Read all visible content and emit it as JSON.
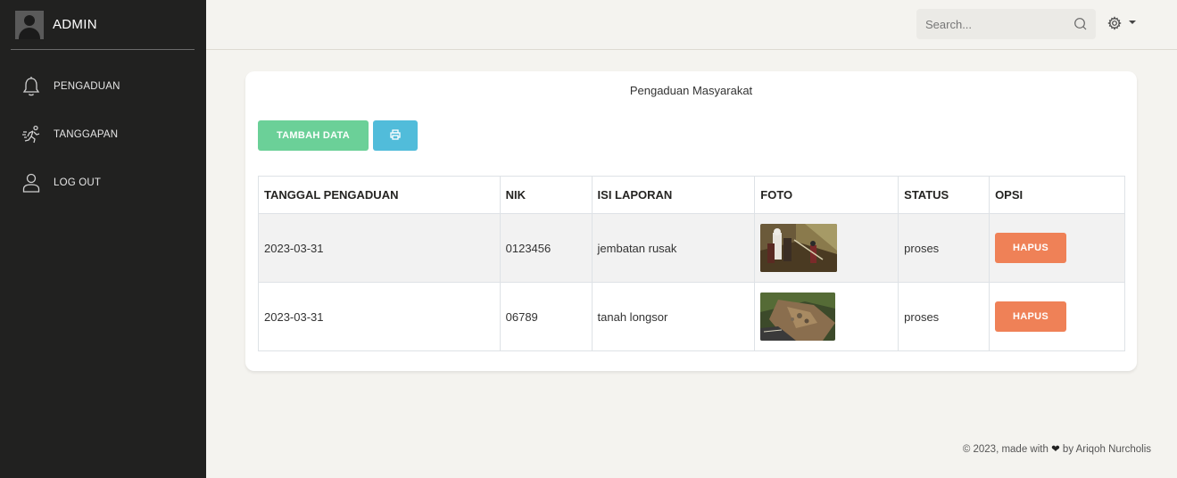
{
  "sidebar": {
    "brand": "ADMIN",
    "items": [
      {
        "label": "PENGADUAN",
        "icon": "bell-icon"
      },
      {
        "label": "TANGGAPAN",
        "icon": "runner-icon"
      },
      {
        "label": "LOG OUT",
        "icon": "user-icon"
      }
    ]
  },
  "topbar": {
    "search_placeholder": "Search..."
  },
  "card": {
    "title": "Pengaduan Masyarakat",
    "add_button": "TAMBAH DATA"
  },
  "table": {
    "headers": [
      "TANGGAL PENGADUAN",
      "NIK",
      "ISI LAPORAN",
      "FOTO",
      "STATUS",
      "OPSI"
    ],
    "rows": [
      {
        "date": "2023-03-31",
        "nik": "0123456",
        "report": "jembatan rusak",
        "status": "proses",
        "action": "HAPUS"
      },
      {
        "date": "2023-03-31",
        "nik": "06789",
        "report": "tanah longsor",
        "status": "proses",
        "action": "HAPUS"
      }
    ]
  },
  "footer": {
    "prefix": "© 2023, made with",
    "heart": "❤",
    "suffix": "by Ariqoh Nurcholis"
  },
  "colors": {
    "sidebar_bg": "#212120",
    "page_bg": "#f4f3ef",
    "success": "#6bd098",
    "info": "#51bcda",
    "danger": "#ef8157"
  }
}
